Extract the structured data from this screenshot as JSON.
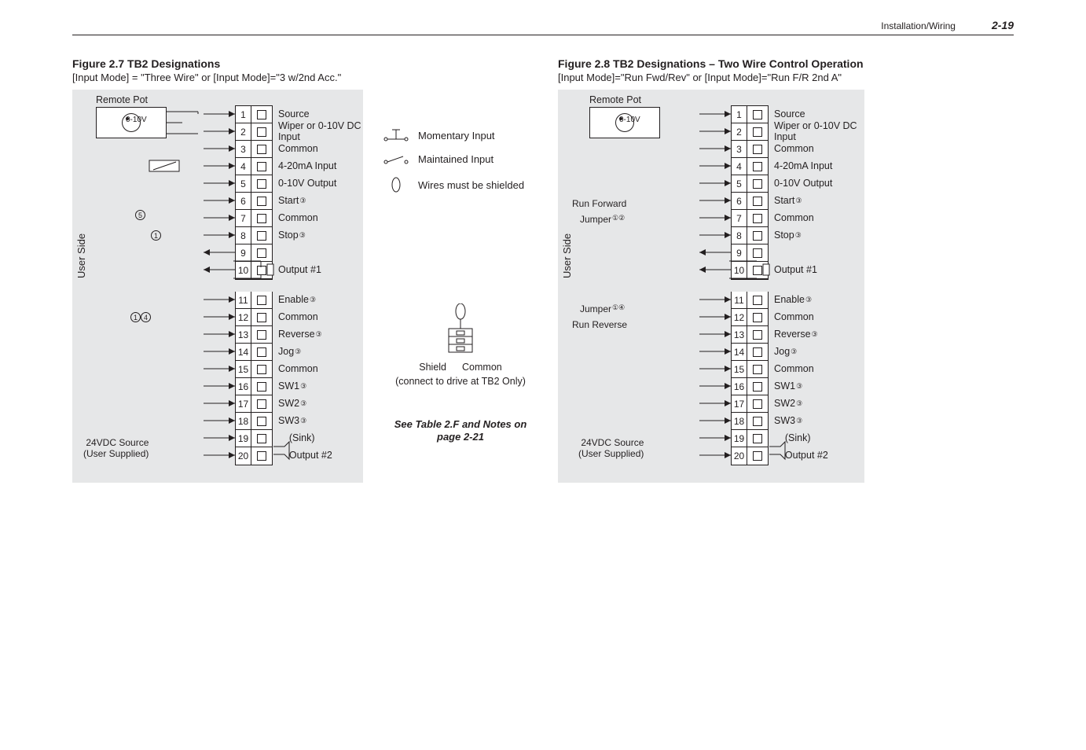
{
  "header": {
    "section": "Installation/Wiring",
    "page": "2-19"
  },
  "fig_left": {
    "title": "Figure 2.7  TB2 Designations",
    "subtitle": "[Input Mode] = \"Three Wire\" or [Input Mode]=\"3 w/2nd Acc.\""
  },
  "fig_right": {
    "title": "Figure 2.8  TB2 Designations – Two Wire Control Operation",
    "subtitle": "[Input Mode]=\"Run Fwd/Rev\" or [Input Mode]=\"Run F/R 2nd A\""
  },
  "common": {
    "remote_pot": "Remote Pot",
    "pot_range": "0-10V",
    "user_side": "User Side",
    "src24": "24VDC Source",
    "src_user": "(User Supplied)",
    "sink": "(Sink)",
    "output2": "Output #2"
  },
  "terminals": [
    "1",
    "2",
    "3",
    "4",
    "5",
    "6",
    "7",
    "8",
    "9",
    "10",
    "11",
    "12",
    "13",
    "14",
    "15",
    "16",
    "17",
    "18",
    "19",
    "20"
  ],
  "labels_a": [
    "Source",
    "Wiper or 0-10V DC Input",
    "Common",
    "4-20mA Input",
    "0-10V Output",
    "Start",
    "Common",
    "Stop",
    "",
    "Output #1",
    "Enable",
    "Common",
    "Reverse",
    "Jog",
    "Common",
    "SW1",
    "SW2",
    "SW3",
    "",
    ""
  ],
  "label_notes": {
    "5": "③",
    "7": "③",
    "10": "③",
    "12": "③",
    "13": "③",
    "15": "③",
    "16": "③",
    "17": "③"
  },
  "legend": {
    "momentary": "Momentary Input",
    "maintained": "Maintained Input",
    "shielded": "Wires must be shielded",
    "shield": "Shield",
    "common": "Common",
    "connect": "(connect to drive at TB2 Only)",
    "see": "See Table 2.F and Notes on page 2-21"
  },
  "right_annot": {
    "run_fwd": "Run Forward",
    "jumper12": "Jumper",
    "jumper12_sup": "①②",
    "jumper14": "Jumper",
    "jumper14_sup": "①④",
    "run_rev": "Run Reverse"
  },
  "left_annot": {
    "n5": "⑤",
    "n1": "①",
    "n14": "①④"
  }
}
